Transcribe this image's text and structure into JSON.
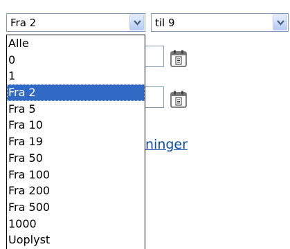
{
  "select_from": {
    "value": "Fra 2"
  },
  "select_to": {
    "value": "til 9"
  },
  "dropdown": {
    "options": [
      "Alle",
      "0",
      "1",
      "Fra 2",
      "Fra 5",
      "Fra 10",
      "Fra 19",
      "Fra 50",
      "Fra 100",
      "Fra 200",
      "Fra 500",
      "1000",
      "Uoplyst"
    ],
    "selected_index": 3
  },
  "partial_link": "ninger",
  "icons": [
    "chevron-down-icon",
    "calendar-icon"
  ],
  "colors": {
    "selection": "#316ac5",
    "border": "#7f9db9",
    "link": "#0a4aa8"
  }
}
